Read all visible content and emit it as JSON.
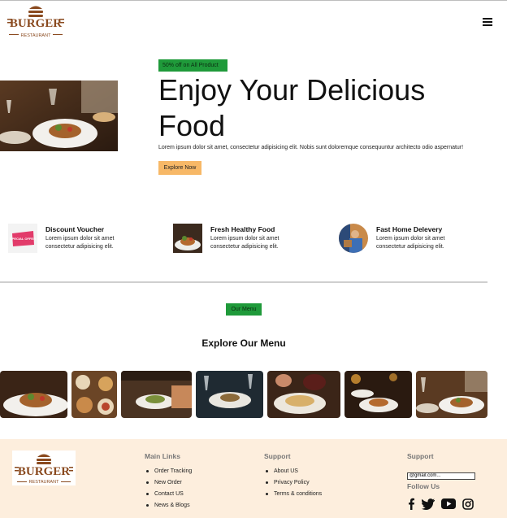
{
  "header": {
    "logo_word": "BURGER",
    "logo_sub": "RESTAURANT"
  },
  "hero": {
    "badge": "50% off on All Product",
    "title": "Enjoy Your Delicious Food",
    "text": "Lorem ipsum dolor sit amet, consectetur adipisicing elit. Nobis sunt doloremque consequuntur architecto odio aspernatur!",
    "button": "Explore Now"
  },
  "features": [
    {
      "title": "Discount Voucher",
      "text": "Lorem ipsum dolor sit amet consectetur adipisicing elit.",
      "icon": "voucher-icon",
      "icon_word": "SPECIAL OFFER"
    },
    {
      "title": "Fresh Healthy Food",
      "text": "Lorem ipsum dolor sit amet consectetur adipisicing elit.",
      "icon": "healthy-food-icon"
    },
    {
      "title": "Fast Home Delevery",
      "text": "Lorem ipsum dolor sit amet consectetur adipisicing elit.",
      "icon": "delivery-icon"
    }
  ],
  "menu": {
    "badge": "Our Menu",
    "heading": "Explore Our Menu"
  },
  "footer": {
    "logo_word": "BURGER",
    "logo_sub": "RESTAURANT",
    "main_links": {
      "title": "Main Links",
      "items": [
        "Order Tracking",
        "New Order",
        "Contact US",
        "News & Blogs"
      ]
    },
    "support_links": {
      "title": "Support",
      "items": [
        "About US",
        "Privacy Policy",
        "Terms & conditions"
      ]
    },
    "support_contact": {
      "title": "Support",
      "email_value": "@gmail.com...",
      "follow": "Follow Us",
      "socials": [
        "facebook-icon",
        "twitter-icon",
        "youtube-icon",
        "instagram-icon"
      ]
    }
  },
  "colors": {
    "badge_green": "#1f9a3a",
    "button_orange": "#f7b867",
    "footer_bg": "#fdeedd",
    "logo_brown": "#8a4a1f"
  }
}
